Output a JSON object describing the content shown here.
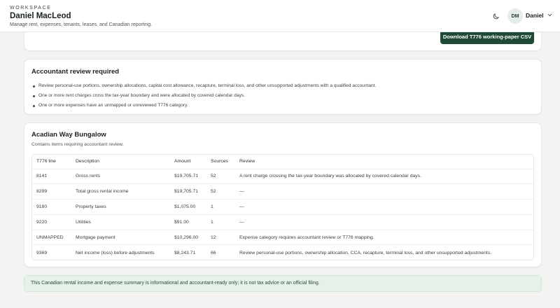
{
  "header": {
    "workspace_label": "WORKSPACE",
    "user_name": "Daniel MacLeod",
    "tagline": "Manage rent, expenses, tenants, leases, and Canadian reporting.",
    "avatar_initials": "DM",
    "account_name": "Daniel"
  },
  "export": {
    "csv_button": "Download T776 working-paper CSV"
  },
  "review": {
    "title": "Accountant review required",
    "items": [
      "Review personal-use portions, ownership allocations, capital cost allowance, recapture, terminal loss, and other unsupported adjustments with a qualified accountant.",
      "One or more rent charges cross the tax-year boundary and were allocated by covered calendar days.",
      "One or more expenses have an unmapped or unreviewed T776 category."
    ]
  },
  "property": {
    "name": "Acadian Way Bungalow",
    "subtitle": "Contains items requiring accountant review.",
    "columns": [
      "T776 line",
      "Description",
      "Amount",
      "Sources",
      "Review"
    ],
    "rows": [
      {
        "line": "8141",
        "description": "Gross rents",
        "amount": "$19,705.71",
        "sources": "52",
        "review": "A rent charge crossing the tax-year boundary was allocated by covered calendar days."
      },
      {
        "line": "8299",
        "description": "Total gross rental income",
        "amount": "$19,705.71",
        "sources": "52",
        "review": "—"
      },
      {
        "line": "9180",
        "description": "Property taxes",
        "amount": "$1,075.00",
        "sources": "1",
        "review": "—"
      },
      {
        "line": "9220",
        "description": "Utilities",
        "amount": "$91.00",
        "sources": "1",
        "review": "—"
      },
      {
        "line": "UNMAPPED",
        "description": "Mortgage payment",
        "amount": "$10,296.00",
        "sources": "12",
        "review": "Expense category requires accountant review or T776 mapping."
      },
      {
        "line": "9369",
        "description": "Net income (loss) before adjustments",
        "amount": "$8,243.71",
        "sources": "66",
        "review": "Review personal-use portions, ownership allocation, CCA, recapture, terminal loss, and other unsupported adjustments."
      }
    ]
  },
  "notice": "This Canadian rental income and expense summary is informational and accountant-ready only; it is not tax advice or an official filing.",
  "icons": {
    "theme": "moon-icon",
    "menu": "chevron-down-icon"
  },
  "colors": {
    "primary": "#1e4a36",
    "notice_bg": "#e6f1e9",
    "page_bg": "#f3f4f2"
  }
}
